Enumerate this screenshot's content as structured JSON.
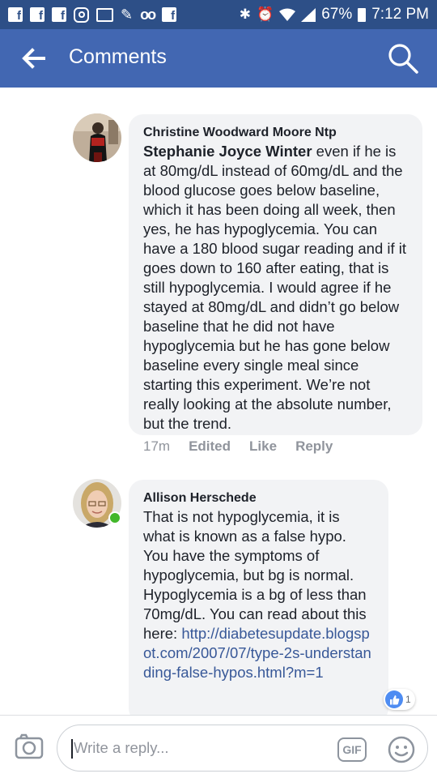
{
  "status_bar": {
    "left_icons": [
      "facebook-icon",
      "facebook-icon",
      "facebook-icon",
      "instagram-icon",
      "image-icon",
      "pen-icon",
      "voicemail-icon",
      "facebook-icon"
    ],
    "fb_glyph": "f",
    "voicemail_glyph": "oo",
    "battery_percent": "67%",
    "time": "7:12 PM"
  },
  "header": {
    "title": "Comments",
    "back_icon": "back-arrow-icon",
    "search_icon": "search-icon",
    "background": "#4267b2"
  },
  "comments": [
    {
      "author": "Christine Woodward Moore Ntp",
      "mention": "Stephanie Joyce Winter",
      "text": " even if he is at 80mg/dL instead of 60mg/dL and the blood glucose goes below baseline, which it has been doing all week, then yes, he has hypoglycemia.  You can have a 180 blood sugar reading and if it goes down to 160 after eating, that is still hypoglycemia.  I would agree if he stayed at 80mg/dL and didn’t go below baseline that he did not have hypoglycemia but he has gone below baseline every single meal since starting this experiment.  We’re not really looking at the absolute number, but the trend.",
      "time": "17m",
      "edited_label": "Edited",
      "like_label": "Like",
      "reply_label": "Reply"
    },
    {
      "author": "Allison Herschede",
      "text": "That is not hypoglycemia, it is what is known as a false hypo. You have the symptoms of hypoglycemia, but bg is normal. Hypoglycemia is a bg of less than 70mg/dL.  You can read about this here: ",
      "link": "http://diabetesupdate.blogspot.com/2007/07/type-2s-understanding-false-hypos.html?m=1",
      "reaction_count": "1",
      "online": true
    }
  ],
  "composer": {
    "placeholder": "Write a reply...",
    "gif_label": "GIF",
    "camera_icon": "camera-icon",
    "emoji_icon": "emoji-icon"
  }
}
